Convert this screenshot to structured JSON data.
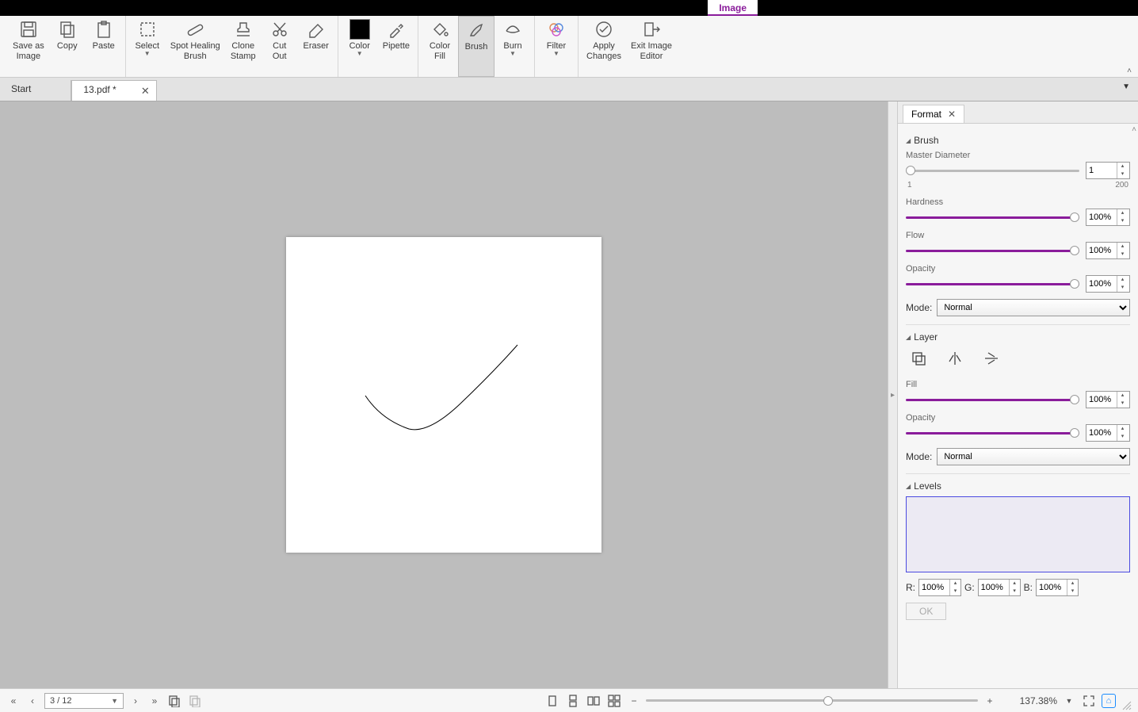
{
  "topbar": {
    "image_tab": "Image"
  },
  "ribbon": {
    "save_as_image": "Save as\nImage",
    "copy": "Copy",
    "paste": "Paste",
    "select": "Select",
    "spot_healing": "Spot Healing\nBrush",
    "clone_stamp": "Clone\nStamp",
    "cut_out": "Cut\nOut",
    "eraser": "Eraser",
    "color": "Color",
    "pipette": "Pipette",
    "color_fill": "Color\nFill",
    "brush": "Brush",
    "burn": "Burn",
    "filter": "Filter",
    "apply_changes": "Apply\nChanges",
    "exit_editor": "Exit Image\nEditor"
  },
  "doctabs": {
    "start": "Start",
    "file": "13.pdf *"
  },
  "format_panel": {
    "title": "Format",
    "brush_section": "Brush",
    "master_diameter": "Master Diameter",
    "md_min": "1",
    "md_max": "200",
    "md_value": "1",
    "hardness": "Hardness",
    "hardness_value": "100%",
    "flow": "Flow",
    "flow_value": "100%",
    "opacity": "Opacity",
    "opacity_value": "100%",
    "mode_label": "Mode:",
    "brush_mode": "Normal",
    "layer_section": "Layer",
    "fill": "Fill",
    "fill_value": "100%",
    "layer_opacity": "Opacity",
    "layer_opacity_value": "100%",
    "layer_mode": "Normal",
    "levels_section": "Levels",
    "r_label": "R:",
    "g_label": "G:",
    "b_label": "B:",
    "r_value": "100%",
    "g_value": "100%",
    "b_value": "100%",
    "ok": "OK"
  },
  "status": {
    "page": "3 / 12",
    "zoom": "137.38%"
  }
}
